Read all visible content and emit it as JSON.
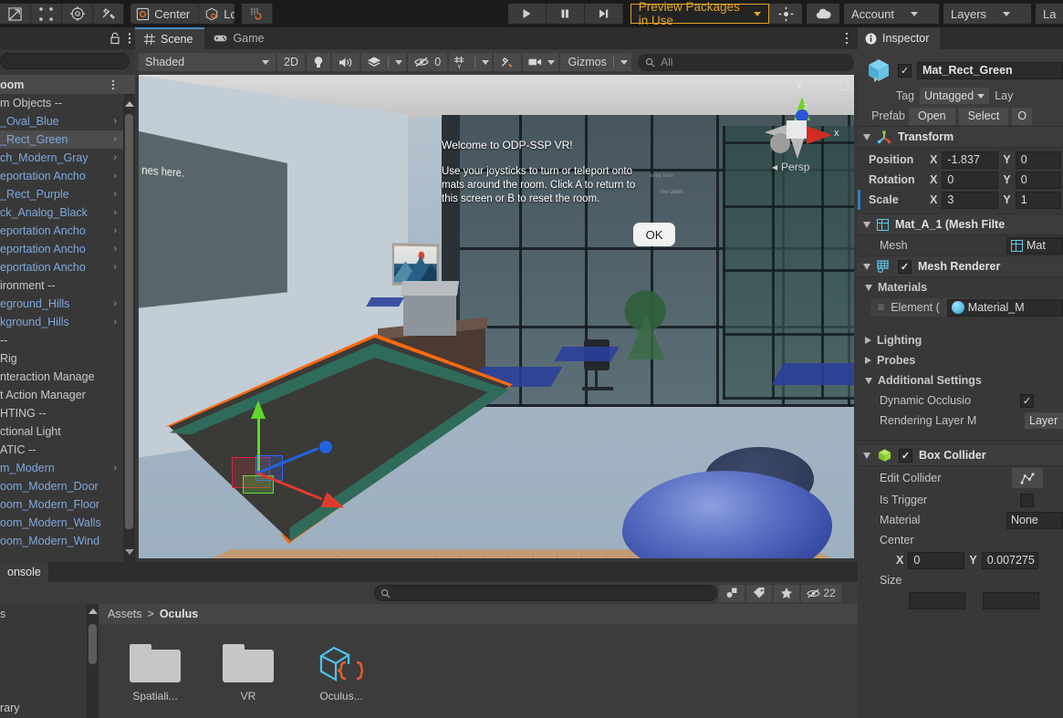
{
  "toolbar": {
    "tools": [
      "move-tool",
      "rect-tool",
      "transform-tool",
      "custom-tool"
    ],
    "pivot_label": "Center",
    "space_label": "Local",
    "grid_label": "grid-snap-icon",
    "play_label": "play-icon",
    "pause_label": "pause-icon",
    "step_label": "step-icon",
    "preview_packages": "Preview Packages in Use",
    "search_icon": "collab-icon",
    "cloud_icon": "cloud-icon",
    "account_label": "Account",
    "layers_label": "Layers",
    "layout_label": "La"
  },
  "hierarchy": {
    "lock_icon": "lock-icon",
    "menu_icon": "kebab-menu-icon",
    "scene_name": "oom",
    "items": [
      {
        "label": "m Objects --",
        "type": "header",
        "expand": false
      },
      {
        "label": "_Oval_Blue",
        "type": "object",
        "expand": true
      },
      {
        "label": "_Rect_Green",
        "type": "object",
        "expand": true,
        "selected": true
      },
      {
        "label": "ch_Modern_Gray",
        "type": "object",
        "expand": true
      },
      {
        "label": "eportation Ancho",
        "type": "object",
        "expand": true
      },
      {
        "label": "_Rect_Purple",
        "type": "object",
        "expand": true
      },
      {
        "label": "ck_Analog_Black",
        "type": "object",
        "expand": true
      },
      {
        "label": "eportation Ancho",
        "type": "object",
        "expand": true
      },
      {
        "label": "eportation Ancho",
        "type": "object",
        "expand": true
      },
      {
        "label": "eportation Ancho",
        "type": "object",
        "expand": true
      },
      {
        "label": "ironment --",
        "type": "header",
        "expand": false
      },
      {
        "label": "eground_Hills",
        "type": "object",
        "expand": true
      },
      {
        "label": "kground_Hills",
        "type": "object",
        "expand": true
      },
      {
        "label": "--",
        "type": "header",
        "expand": false
      },
      {
        "label": "Rig",
        "type": "header",
        "expand": false
      },
      {
        "label": "nteraction Manage",
        "type": "header",
        "expand": false
      },
      {
        "label": "t Action Manager",
        "type": "header",
        "expand": false
      },
      {
        "label": "HTING --",
        "type": "header",
        "expand": false
      },
      {
        "label": "ctional Light",
        "type": "header",
        "expand": false
      },
      {
        "label": "ATIC --",
        "type": "header",
        "expand": false
      },
      {
        "label": "m_Modern",
        "type": "object",
        "expand": true
      },
      {
        "label": "oom_Modern_Door",
        "type": "object",
        "expand": false
      },
      {
        "label": "oom_Modern_Floor",
        "type": "object",
        "expand": false
      },
      {
        "label": "oom_Modern_Walls",
        "type": "object",
        "expand": false
      },
      {
        "label": "oom_Modern_Wind",
        "type": "object",
        "expand": false
      }
    ]
  },
  "scene": {
    "tabs": [
      {
        "label": "Scene",
        "icon": "grid-icon",
        "active": true
      },
      {
        "label": "Game",
        "icon": "gamepad-icon",
        "active": false
      }
    ],
    "menu_icon": "kebab-menu-icon",
    "draw_mode": "Shaded",
    "toggle_2d": "2D",
    "lighting_icon": "light-bulb-icon",
    "audio_icon": "speaker-icon",
    "fx_icon": "effects-icon",
    "hidden_count": "0",
    "grid_icon": "grid-axis-icon",
    "tools_icon": "tools-icon",
    "camera_icon": "camera-icon",
    "gizmos_label": "Gizmos",
    "search_placeholder": "All",
    "axis_labels": {
      "x": "x",
      "y": "y",
      "z": "z"
    },
    "projection_label": "Persp",
    "lock_icon": "lock-icon",
    "board_text": "nes here.",
    "vr_dialog": {
      "title": "Welcome to ODP-SSP VR!",
      "body_line1": "Use your joysticks to turn or teleport onto",
      "body_line2": "mats around the room. Click A to return to",
      "body_line3": "this screen or B to reset the room.",
      "ok_label": "OK"
    },
    "faded_text_1": "ently runn",
    "faded_text_2": "the tablet"
  },
  "project": {
    "tabs": [
      {
        "label": "onsole",
        "active": true
      }
    ],
    "search_icon": "search-icon",
    "search_value": "",
    "icon_buttons": [
      "asset-filter-icon",
      "label-filter-icon",
      "favorite-icon"
    ],
    "hidden_count": "22",
    "tree_items": [
      "s",
      "rary"
    ],
    "breadcrumb": [
      "Assets",
      "Oculus"
    ],
    "breadcrumb_sep": ">",
    "items": [
      {
        "name": "Spatiali...",
        "icon": "folder-icon"
      },
      {
        "name": "VR",
        "icon": "folder-icon"
      },
      {
        "name": "Oculus...",
        "icon": "script-asset-icon"
      }
    ]
  },
  "inspector": {
    "tab_label": "Inspector",
    "tab_icon": "info-icon",
    "object_name": "Mat_Rect_Green",
    "object_enabled": true,
    "tag_label": "Tag",
    "tag_value": "Untagged",
    "layer_label": "Lay",
    "prefab_label": "Prefab",
    "prefab_open": "Open",
    "prefab_select": "Select",
    "prefab_overrides": "O",
    "transform": {
      "title": "Transform",
      "icon": "transform-icon",
      "rows": [
        {
          "name": "Position",
          "x": "-1.837",
          "y": "0"
        },
        {
          "name": "Rotation",
          "x": "0",
          "y": "0"
        },
        {
          "name": "Scale",
          "x": "3",
          "y": "1"
        }
      ]
    },
    "mesh_filter": {
      "title": "Mat_A_1 (Mesh Filte",
      "icon": "mesh-filter-icon",
      "mesh_label": "Mesh",
      "mesh_value": "Mat"
    },
    "mesh_renderer": {
      "title": "Mesh Renderer",
      "icon": "mesh-renderer-icon",
      "enabled": true,
      "materials_label": "Materials",
      "element_label": "Element (",
      "element_value": "Material_M",
      "lighting_label": "Lighting",
      "probes_label": "Probes",
      "additional_label": "Additional Settings",
      "dynamic_occlusion_label": "Dynamic Occlusio",
      "dynamic_occlusion_checked": true,
      "rendering_layer_label": "Rendering Layer M",
      "rendering_layer_value": "Layer"
    },
    "box_collider": {
      "title": "Box Collider",
      "icon": "box-collider-icon",
      "enabled": true,
      "edit_collider_label": "Edit Collider",
      "edit_collider_icon": "edit-collider-icon",
      "is_trigger_label": "Is Trigger",
      "is_trigger_checked": false,
      "material_label": "Material",
      "material_value": "None",
      "center_label": "Center",
      "center_x": "0",
      "center_y": "0.007275",
      "size_label": "Size"
    }
  },
  "colors": {
    "accent_orange": "#ff6a10",
    "amber": "#e0a423",
    "panel_bg": "#383838",
    "toolbar_bg": "#1b1b1b",
    "select_blue": "#4d4d4d",
    "link_blue": "#7fa8dd"
  }
}
